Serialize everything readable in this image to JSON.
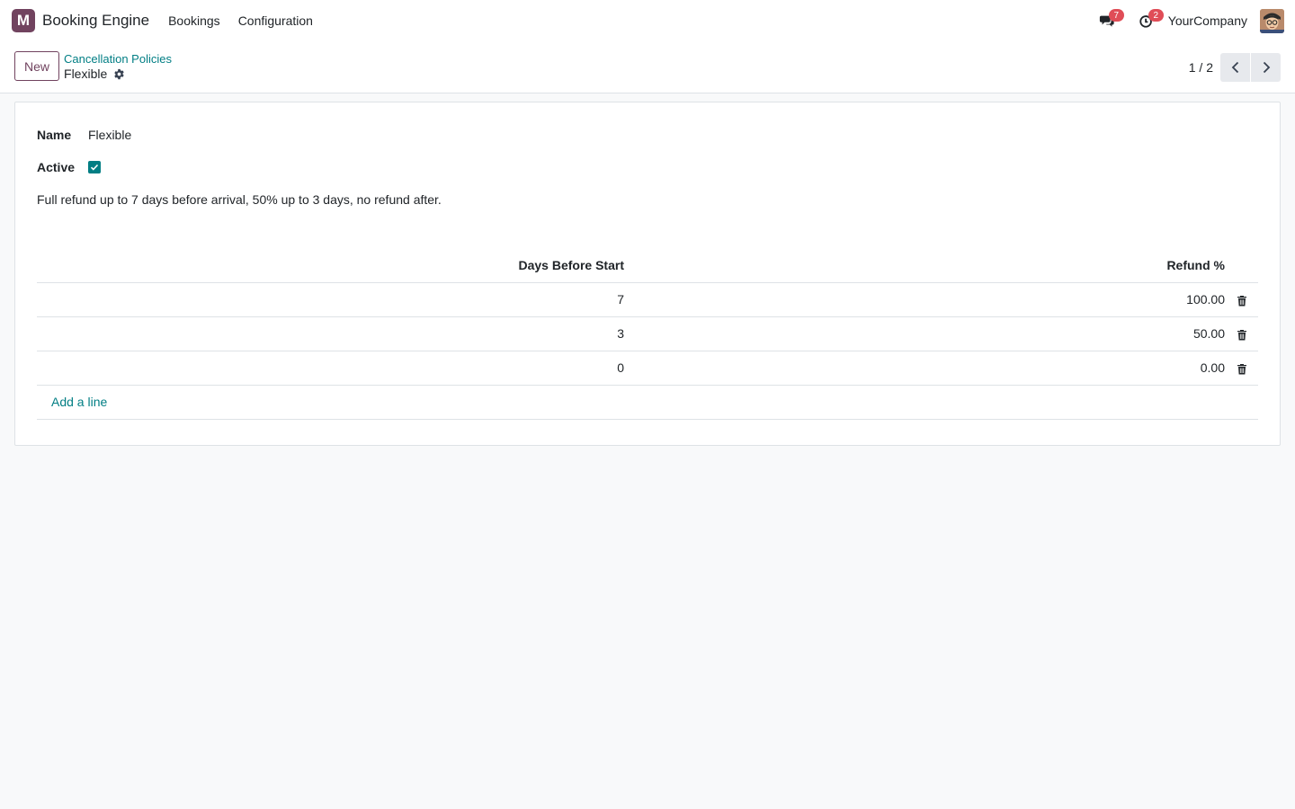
{
  "navbar": {
    "app_logo_letter": "M",
    "app_name": "Booking Engine",
    "menu": [
      {
        "label": "Bookings"
      },
      {
        "label": "Configuration"
      }
    ],
    "messages_badge": "7",
    "activities_badge": "2",
    "company": "YourCompany",
    "icons": {
      "messages": "chat-bubbles-icon",
      "activities": "clock-icon"
    }
  },
  "control_panel": {
    "new_label": "New",
    "breadcrumb_parent": "Cancellation Policies",
    "breadcrumb_current": "Flexible",
    "pager": "1 / 2"
  },
  "form": {
    "name_label": "Name",
    "name_value": "Flexible",
    "active_label": "Active",
    "active_checked": true,
    "description": "Full refund up to 7 days before arrival, 50% up to 3 days, no refund after.",
    "table": {
      "headers": {
        "days": "Days Before Start",
        "refund": "Refund %"
      },
      "rows": [
        {
          "days": "7",
          "refund": "100.00"
        },
        {
          "days": "3",
          "refund": "50.00"
        },
        {
          "days": "0",
          "refund": "0.00"
        }
      ],
      "add_line": "Add a line"
    }
  },
  "colors": {
    "brand": "#71435f",
    "accent": "#017e84",
    "badge": "#e04d57"
  }
}
